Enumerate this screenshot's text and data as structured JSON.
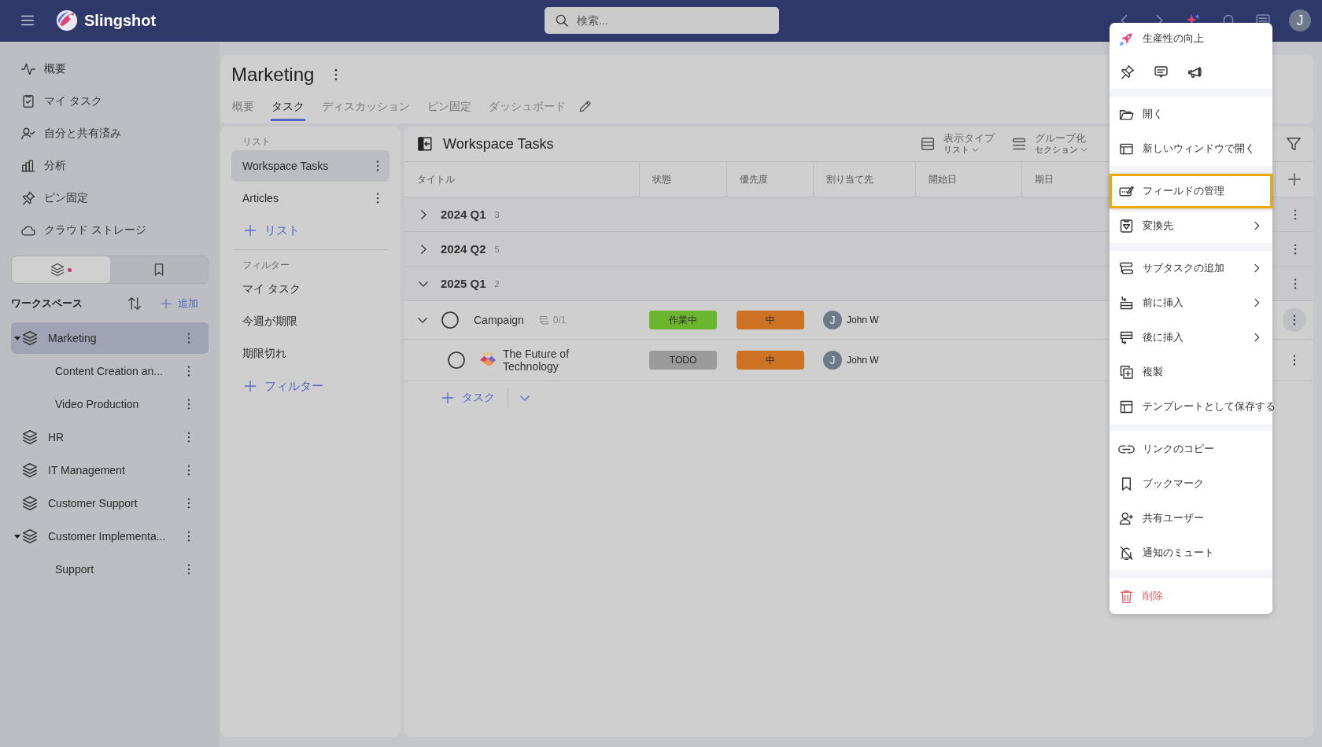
{
  "topbar": {
    "app_name": "Slingshot",
    "search_placeholder": "検索...",
    "avatar": "J"
  },
  "nav": [
    {
      "label": "概要"
    },
    {
      "label": "マイ タスク"
    },
    {
      "label": "自分と共有済み"
    },
    {
      "label": "分析"
    },
    {
      "label": "ピン固定"
    },
    {
      "label": "クラウド ストレージ"
    }
  ],
  "sidebar_tabs": [
    {
      "selected": true
    },
    {
      "selected": false
    }
  ],
  "workspaces": {
    "title": "ワークスペース",
    "add": "追加",
    "items": [
      {
        "label": "Marketing",
        "selected": true,
        "expanded": true,
        "children": [
          {
            "label": "Content Creation an...",
            "selected": false
          },
          {
            "label": "Video Production",
            "selected": false
          }
        ]
      },
      {
        "label": "HR",
        "selected": false
      },
      {
        "label": "IT Management",
        "selected": false
      },
      {
        "label": "Customer Support",
        "selected": false
      },
      {
        "label": "Customer Implementa...",
        "selected": false,
        "expanded": true,
        "children": [
          {
            "label": "Support",
            "selected": false
          }
        ]
      }
    ]
  },
  "project": {
    "title": "Marketing",
    "tabs": [
      {
        "label": "概要",
        "selected": false
      },
      {
        "label": "タスク",
        "selected": true
      },
      {
        "label": "ディスカッション",
        "selected": false
      },
      {
        "label": "ピン固定",
        "selected": false
      },
      {
        "label": "ダッシュボード",
        "selected": false
      }
    ]
  },
  "lists": {
    "title": "リスト",
    "items": [
      {
        "label": "Workspace Tasks",
        "selected": true
      },
      {
        "label": "Articles",
        "selected": false
      }
    ],
    "add": "リスト"
  },
  "filters": {
    "title": "フィルター",
    "items": [
      {
        "label": "マイ タスク",
        "selected": false
      },
      {
        "label": "今週が期限",
        "selected": false
      },
      {
        "label": "期限切れ",
        "selected": false
      }
    ],
    "add": "フィルター"
  },
  "tasks": {
    "title": "Workspace Tasks",
    "view_type": {
      "label": "表示タイプ",
      "value": "リスト"
    },
    "group_by": {
      "label": "グループ化",
      "value": "セクション"
    },
    "columns": [
      "タイトル",
      "状態",
      "優先度",
      "割り当て先",
      "開始日",
      "期日"
    ],
    "groups": [
      {
        "title": "2024 Q1",
        "count": "3",
        "expanded": false
      },
      {
        "title": "2024 Q2",
        "count": "5",
        "expanded": false
      },
      {
        "title": "2025 Q1",
        "count": "2",
        "expanded": true,
        "tasks": [
          {
            "title": "Campaign",
            "completed": false,
            "expanded": true,
            "subtasks": "0/1",
            "status": {
              "label": "作業中",
              "color": "#6cb52e"
            },
            "priority": {
              "label": "中",
              "color": "#cc7223"
            },
            "assignee": {
              "initial": "J",
              "name": "John W"
            },
            "children": [
              {
                "title": "The Future of Technology",
                "completed": false,
                "status": {
                  "label": "TODO",
                  "color": "#9b9b9b"
                },
                "priority": {
                  "label": "中",
                  "color": "#cc7223"
                },
                "assignee": {
                  "initial": "J",
                  "name": "John W"
                }
              }
            ]
          }
        ]
      }
    ],
    "add_task": "タスク"
  },
  "menu": {
    "sections": [
      {
        "items": [
          {
            "kind": "feature",
            "label": "生産性の向上"
          },
          {
            "kind": "icons"
          }
        ]
      },
      {
        "items": [
          {
            "kind": "action",
            "label": "開く"
          },
          {
            "kind": "action",
            "label": "新しいウィンドウで開く"
          }
        ]
      },
      {
        "items": [
          {
            "kind": "action",
            "label": "フィールドの管理",
            "highlighted": true
          },
          {
            "kind": "action",
            "label": "変換先",
            "submenu": true
          }
        ]
      },
      {
        "items": [
          {
            "kind": "action",
            "label": "サブタスクの追加",
            "submenu": true
          },
          {
            "kind": "action",
            "label": "前に挿入",
            "submenu": true
          },
          {
            "kind": "action",
            "label": "後に挿入",
            "submenu": true
          },
          {
            "kind": "action",
            "label": "複製"
          },
          {
            "kind": "action",
            "label": "テンプレートとして保存する"
          }
        ]
      },
      {
        "items": [
          {
            "kind": "action",
            "label": "リンクのコピー"
          },
          {
            "kind": "action",
            "label": "ブックマーク"
          },
          {
            "kind": "action",
            "label": "共有ユーザー"
          },
          {
            "kind": "action",
            "label": "通知のミュート"
          }
        ]
      },
      {
        "items": [
          {
            "kind": "danger",
            "label": "削除"
          }
        ]
      }
    ]
  }
}
